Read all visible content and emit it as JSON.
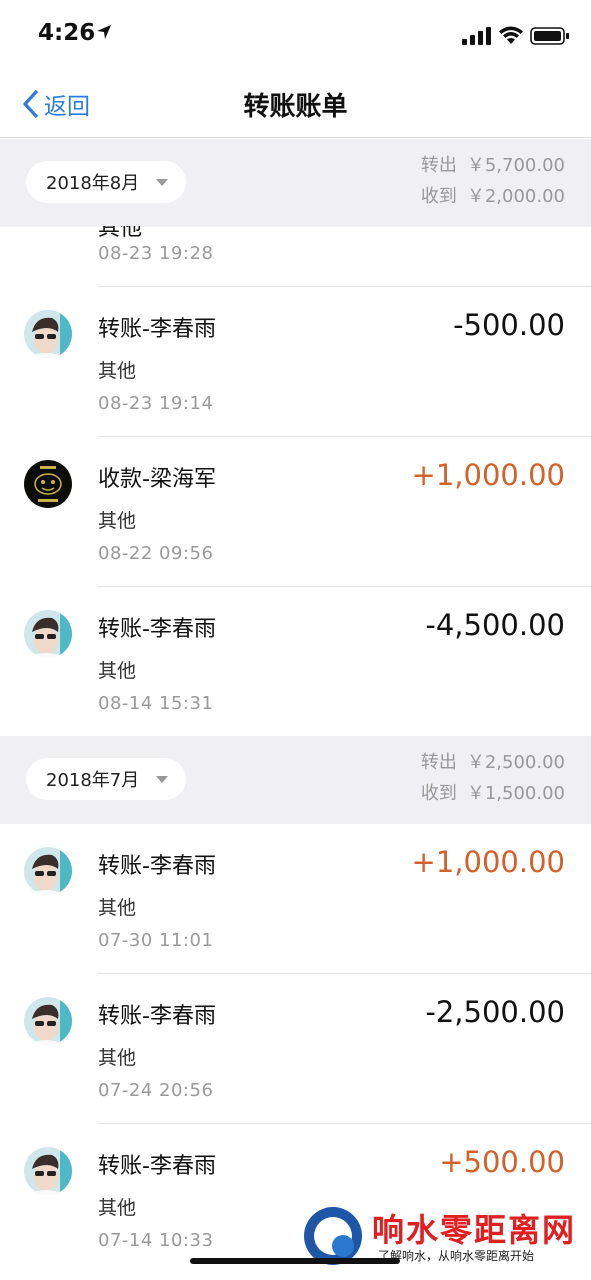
{
  "status_bar": {
    "time": "4:26"
  },
  "nav": {
    "back_label": "返回",
    "title": "转账账单"
  },
  "partial_entry": {
    "title": "其他",
    "date": "08-23  19:28"
  },
  "months": [
    {
      "month": "2018年8月",
      "out_label": "转出",
      "out_amount": "￥5,700.00",
      "in_label": "收到",
      "in_amount": "￥2,000.00",
      "entries": [
        {
          "title": "转账-李春雨",
          "category": "其他",
          "date": "08-23  19:14",
          "amount": "-500.00",
          "type": "out",
          "avatar": "boy-avatar"
        },
        {
          "title": "收款-梁海军",
          "category": "其他",
          "date": "08-22  09:56",
          "amount": "+1,000.00",
          "type": "in",
          "avatar": "dark-logo-avatar"
        },
        {
          "title": "转账-李春雨",
          "category": "其他",
          "date": "08-14  15:31",
          "amount": "-4,500.00",
          "type": "out",
          "avatar": "boy-avatar"
        }
      ]
    },
    {
      "month": "2018年7月",
      "out_label": "转出",
      "out_amount": "￥2,500.00",
      "in_label": "收到",
      "in_amount": "￥1,500.00",
      "entries": [
        {
          "title": "转账-李春雨",
          "category": "其他",
          "date": "07-30  11:01",
          "amount": "+1,000.00",
          "type": "in",
          "avatar": "boy-avatar"
        },
        {
          "title": "转账-李春雨",
          "category": "其他",
          "date": "07-24  20:56",
          "amount": "-2,500.00",
          "type": "out",
          "avatar": "boy-avatar"
        },
        {
          "title": "转账-李春雨",
          "category": "其他",
          "date": "07-14  10:33",
          "amount": "+500.00",
          "type": "in",
          "avatar": "boy-avatar"
        }
      ]
    }
  ],
  "watermark": {
    "title": "响水零距离网",
    "subtitle": "了解响水，从响水零距离开始"
  },
  "colors": {
    "accent": "#2b7de0",
    "positive": "#d2612b",
    "negative": "#111111",
    "section_bg": "#f0f0f2"
  }
}
